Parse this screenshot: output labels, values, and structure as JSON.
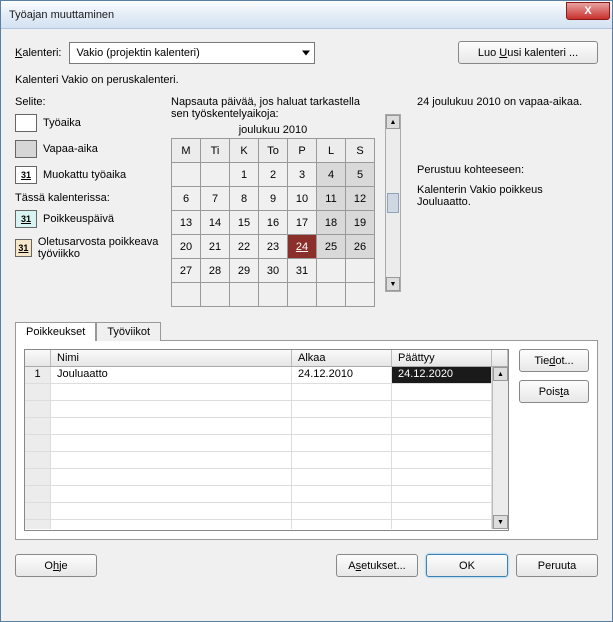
{
  "title": "Työajan muuttaminen",
  "close_x": "X",
  "labels": {
    "kalenteri": "Kalenteri:",
    "luo_uusi": "Luo Uusi kalenteri ...",
    "subtext": "Kalenteri Vakio on peruskalenteri.",
    "selite": "Selite:",
    "cal_instr": "Napsauta päivää, jos haluat tarkastella sen työskentelyaikoja:",
    "tassa": "Tässä kalenterissa:",
    "info1": "24 joulukuu 2010 on vapaa-aikaa.",
    "info2": "Perustuu kohteeseen:",
    "info3": "Kalenterin Vakio poikkeus Jouluaatto."
  },
  "combo": {
    "value": "Vakio (projektin kalenteri)"
  },
  "legend": {
    "tyoaika": "Työaika",
    "vapaa": "Vapaa-aika",
    "muokattu": "Muokattu työaika",
    "poikkeus": "Poikkeuspäivä",
    "oletus": "Oletusarvosta poikkeava työviikko",
    "n31": "31"
  },
  "calendar": {
    "title": "joulukuu 2010",
    "dow": [
      "M",
      "Ti",
      "K",
      "To",
      "P",
      "L",
      "S"
    ],
    "weeks": [
      [
        "",
        "",
        "1",
        "2",
        "3",
        "4",
        "5"
      ],
      [
        "6",
        "7",
        "8",
        "9",
        "10",
        "11",
        "12"
      ],
      [
        "13",
        "14",
        "15",
        "16",
        "17",
        "18",
        "19"
      ],
      [
        "20",
        "21",
        "22",
        "23",
        "24",
        "25",
        "26"
      ],
      [
        "27",
        "28",
        "29",
        "30",
        "31",
        "",
        ""
      ],
      [
        "",
        "",
        "",
        "",
        "",
        "",
        ""
      ]
    ],
    "selected": "24"
  },
  "tabs": {
    "poikkeukset": "Poikkeukset",
    "tyoviikot": "Työviikot"
  },
  "grid": {
    "headers": {
      "nimi": "Nimi",
      "alkaa": "Alkaa",
      "paattyy": "Päättyy"
    },
    "rows": [
      {
        "n": "1",
        "nimi": "Jouluaatto",
        "alkaa": "24.12.2010",
        "paattyy": "24.12.2020"
      }
    ]
  },
  "buttons": {
    "tiedot": "Tiedot...",
    "poista": "Poista",
    "ohje": "Ohje",
    "asetukset": "Asetukset...",
    "ok": "OK",
    "peruuta": "Peruuta"
  }
}
